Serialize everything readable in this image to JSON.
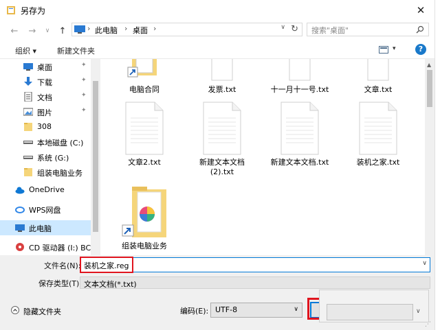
{
  "window": {
    "title": "另存为",
    "close_glyph": "✕"
  },
  "nav": {
    "breadcrumb": [
      "此电脑",
      "桌面"
    ],
    "search_placeholder": "搜索\"桌面\""
  },
  "toolbar": {
    "organize": "组织 ▾",
    "new_folder": "新建文件夹"
  },
  "sidebar": {
    "items": [
      {
        "label": "桌面",
        "icon": "desktop-icon",
        "pinned": true
      },
      {
        "label": "下载",
        "icon": "download-icon",
        "pinned": true
      },
      {
        "label": "文档",
        "icon": "document-icon",
        "pinned": true
      },
      {
        "label": "图片",
        "icon": "picture-icon",
        "pinned": true
      },
      {
        "label": "308",
        "icon": "folder-icon",
        "pinned": false
      },
      {
        "label": "本地磁盘 (C:)",
        "icon": "drive-icon",
        "pinned": false
      },
      {
        "label": "系统 (G:)",
        "icon": "drive-icon",
        "pinned": false
      },
      {
        "label": "组装电脑业务",
        "icon": "folder-icon",
        "pinned": false
      },
      {
        "label": "OneDrive",
        "icon": "cloud-icon",
        "pinned": false
      },
      {
        "label": "WPS网盘",
        "icon": "wps-cloud-icon",
        "pinned": false
      },
      {
        "label": "此电脑",
        "icon": "pc-icon",
        "pinned": false,
        "selected": true
      },
      {
        "label": "CD 驱动器 (I:) BC",
        "icon": "cd-drive-icon",
        "pinned": false
      }
    ]
  },
  "files": [
    {
      "label": "电脑合同",
      "type": "folder-shortcut"
    },
    {
      "label": "发票.txt",
      "type": "txt"
    },
    {
      "label": "十一月十一号.txt",
      "type": "txt"
    },
    {
      "label": "文章.txt",
      "type": "txt"
    },
    {
      "label": "文章2.txt",
      "type": "txt"
    },
    {
      "label": "新建文本文档",
      "label2": "(2).txt",
      "type": "txt"
    },
    {
      "label": "新建文本文档.txt",
      "type": "txt"
    },
    {
      "label": "装机之家.txt",
      "type": "txt"
    },
    {
      "label": "组装电脑业务",
      "type": "folder-shortcut"
    }
  ],
  "form": {
    "filename_label": "文件名(N):",
    "filename_value": "装机之家.reg",
    "filetype_label": "保存类型(T):",
    "filetype_value": "文本文档(*.txt)",
    "hide_folders": "隐藏文件夹",
    "encoding_label": "编码(E):",
    "encoding_value": "UTF-8"
  },
  "colors": {
    "accent": "#0078d7",
    "highlight": "#e0141e",
    "selection": "#cce8ff"
  }
}
